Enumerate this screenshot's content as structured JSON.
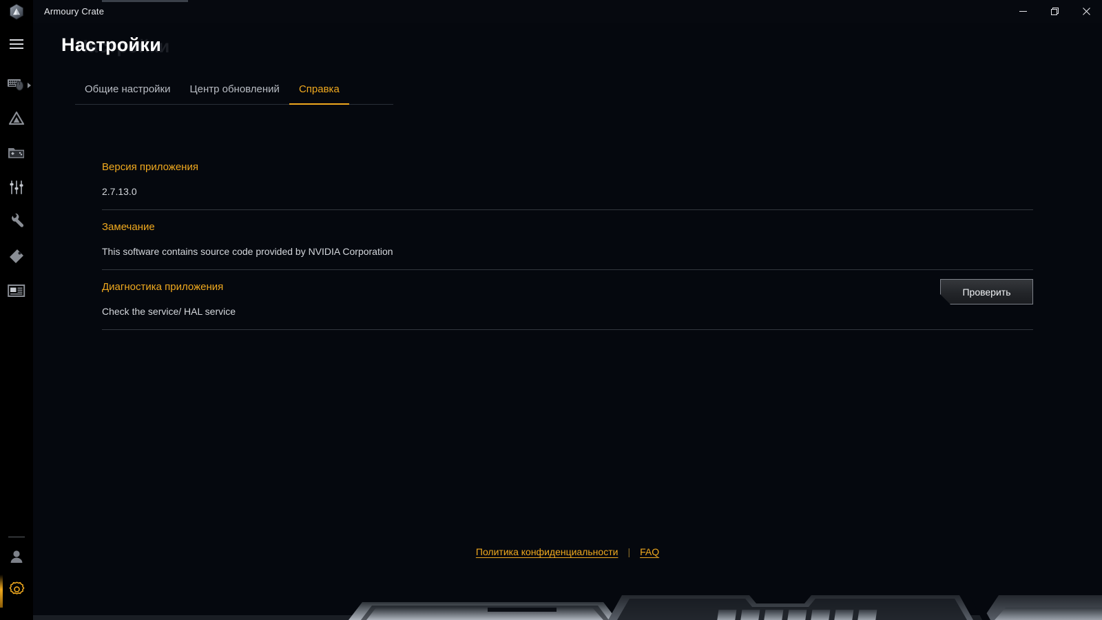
{
  "window": {
    "app_title": "Armoury Crate",
    "logo_icon": "armoury-crate-hex-logo",
    "controls": {
      "minimize": "─",
      "restore": "❐",
      "close": "✕"
    }
  },
  "sidebar": {
    "menu_toggle": "hamburger-menu-icon",
    "items": [
      {
        "icon": "keyboard-mouse-icon",
        "name": "devices",
        "has_arrow": true
      },
      {
        "icon": "aura-triangle-icon",
        "name": "aura-sync"
      },
      {
        "icon": "game-library-icon",
        "name": "game-library"
      },
      {
        "icon": "sliders-icon",
        "name": "scenario-profiles"
      },
      {
        "icon": "wrench-icon",
        "name": "tools"
      },
      {
        "icon": "tag-icon",
        "name": "featured"
      },
      {
        "icon": "window-news-icon",
        "name": "news"
      }
    ],
    "bottom_items": [
      {
        "icon": "user-account-icon",
        "name": "user-account",
        "active": false
      },
      {
        "icon": "gear-settings-icon",
        "name": "settings",
        "active": true
      }
    ]
  },
  "header": {
    "title": "Настройки",
    "title_ghost": "Настройки"
  },
  "tabs": [
    {
      "label": "Общие настройки",
      "active": false
    },
    {
      "label": "Центр обновлений",
      "active": false
    },
    {
      "label": "Справка",
      "active": true
    }
  ],
  "rows": [
    {
      "heading": "Версия приложения",
      "value": "2.7.13.0",
      "button": null
    },
    {
      "heading": "Замечание",
      "value": "This software contains source code provided by NVIDIA Corporation",
      "button": null
    },
    {
      "heading": "Диагностика приложения",
      "value": "Check the service/ HAL service",
      "button": "Проверить"
    }
  ],
  "footer": {
    "privacy_label": "Политика конфиденциальности",
    "separator": "|",
    "faq_label": "FAQ"
  },
  "colors": {
    "accent": "#f0a91e",
    "background": "#05080e",
    "sidebar": "#000000",
    "text": "#d4d7dc"
  }
}
